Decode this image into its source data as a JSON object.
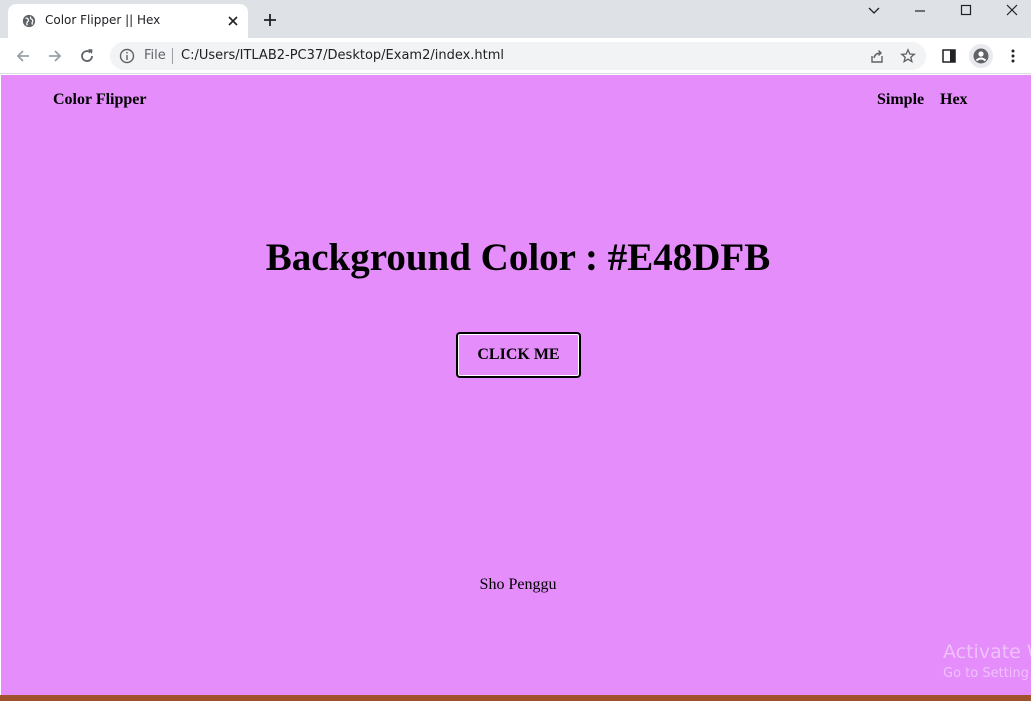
{
  "browser": {
    "tab": {
      "title": "Color Flipper || Hex"
    },
    "toolbar": {
      "file_label": "File",
      "url": "C:/Users/ITLAB2-PC37/Desktop/Exam2/index.html"
    }
  },
  "page": {
    "background_color": "#E48DFB",
    "brand": "Color Flipper",
    "nav": [
      "Simple",
      "Hex"
    ],
    "headline": "Background Color : #E48DFB",
    "button_label": "CLICK ME",
    "footer": "Sho Penggu"
  },
  "overlay": {
    "line1": "Activate W",
    "line2": "Go to Setting"
  },
  "icons": [
    "globe-icon",
    "close-icon",
    "plus-icon",
    "chevron-down-icon",
    "minimize-icon",
    "maximize-icon",
    "close-window-icon",
    "back-arrow-icon",
    "forward-arrow-icon",
    "reload-icon",
    "info-icon",
    "share-icon",
    "star-icon",
    "side-panel-icon",
    "profile-icon",
    "more-menu-icon"
  ]
}
